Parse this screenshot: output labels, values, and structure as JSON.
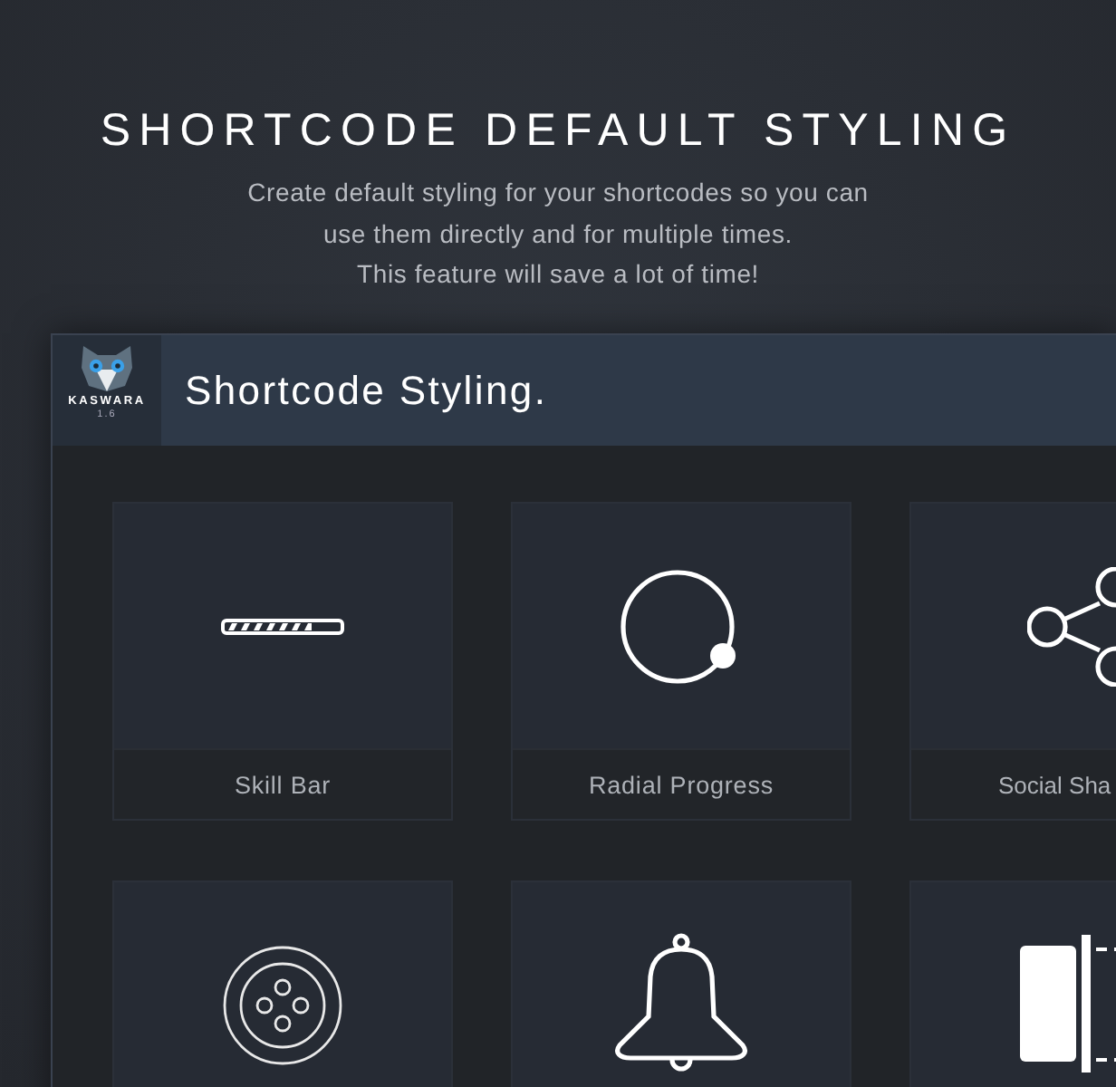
{
  "heading": {
    "title": "SHORTCODE DEFAULT STYLING",
    "lines": [
      "Create default styling for your shortcodes so you can",
      "use them directly and for multiple times.",
      "This feature will save a lot of time!"
    ]
  },
  "panel": {
    "logo": {
      "name": "KASWARA",
      "version": "1.6"
    },
    "title": "Shortcode Styling."
  },
  "cards": [
    {
      "kind": "skill-bar",
      "label": "Skill Bar"
    },
    {
      "kind": "radial",
      "label": "Radial Progress"
    },
    {
      "kind": "share",
      "label": "Social Sha"
    },
    {
      "kind": "button"
    },
    {
      "kind": "bell"
    },
    {
      "kind": "slider"
    }
  ]
}
